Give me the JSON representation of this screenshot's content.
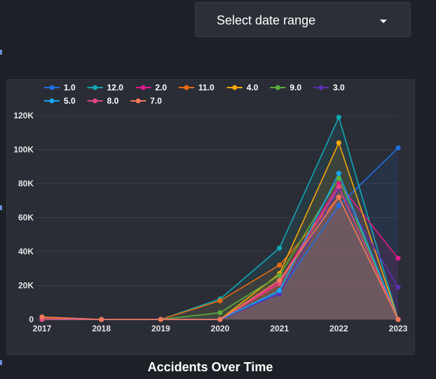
{
  "controls": {
    "date_range_label": "Select date range",
    "caret_icon": "caret-down-icon"
  },
  "chart_title": "Accidents Over Time",
  "colors": {
    "background": "#1d2026",
    "panel": "#2a2d36",
    "grid": "#3a3d46"
  },
  "chart_data": {
    "type": "line",
    "title": "Accidents Over Time",
    "xlabel": "",
    "ylabel": "",
    "x": [
      "2017",
      "2018",
      "2019",
      "2020",
      "2021",
      "2022",
      "2023"
    ],
    "ylim": [
      0,
      120000
    ],
    "yticks": [
      0,
      20000,
      40000,
      60000,
      80000,
      100000,
      120000
    ],
    "ytick_labels": [
      "0",
      "20K",
      "40K",
      "60K",
      "80K",
      "100K",
      "120K"
    ],
    "grid": true,
    "legend_position": "top-left",
    "area_fill": true,
    "series": [
      {
        "name": "1.0",
        "color": "#1f6fe0",
        "values": [
          0,
          0,
          0,
          0,
          16000,
          67000,
          101000
        ]
      },
      {
        "name": "12.0",
        "color": "#12a8b4",
        "values": [
          0,
          0,
          0,
          12000,
          42000,
          119000,
          0
        ]
      },
      {
        "name": "2.0",
        "color": "#e0198c",
        "values": [
          0,
          0,
          0,
          0,
          22000,
          80000,
          36000
        ]
      },
      {
        "name": "11.0",
        "color": "#e8690f",
        "values": [
          1000,
          0,
          0,
          11000,
          32000,
          72000,
          0
        ]
      },
      {
        "name": "4.0",
        "color": "#f5a70a",
        "values": [
          0,
          0,
          0,
          0,
          27000,
          104000,
          0
        ]
      },
      {
        "name": "9.0",
        "color": "#5cac3e",
        "values": [
          0,
          0,
          0,
          4000,
          26000,
          83000,
          0
        ]
      },
      {
        "name": "3.0",
        "color": "#5b2fb0",
        "values": [
          0,
          0,
          0,
          0,
          15000,
          77000,
          19000
        ]
      },
      {
        "name": "5.0",
        "color": "#15a7ef",
        "values": [
          0,
          0,
          0,
          0,
          17000,
          86000,
          0
        ]
      },
      {
        "name": "8.0",
        "color": "#e2477f",
        "values": [
          0,
          0,
          0,
          0,
          21000,
          78000,
          0
        ]
      },
      {
        "name": "7.0",
        "color": "#f2795a",
        "values": [
          1500,
          0,
          0,
          0,
          23000,
          72000,
          0
        ]
      }
    ]
  }
}
